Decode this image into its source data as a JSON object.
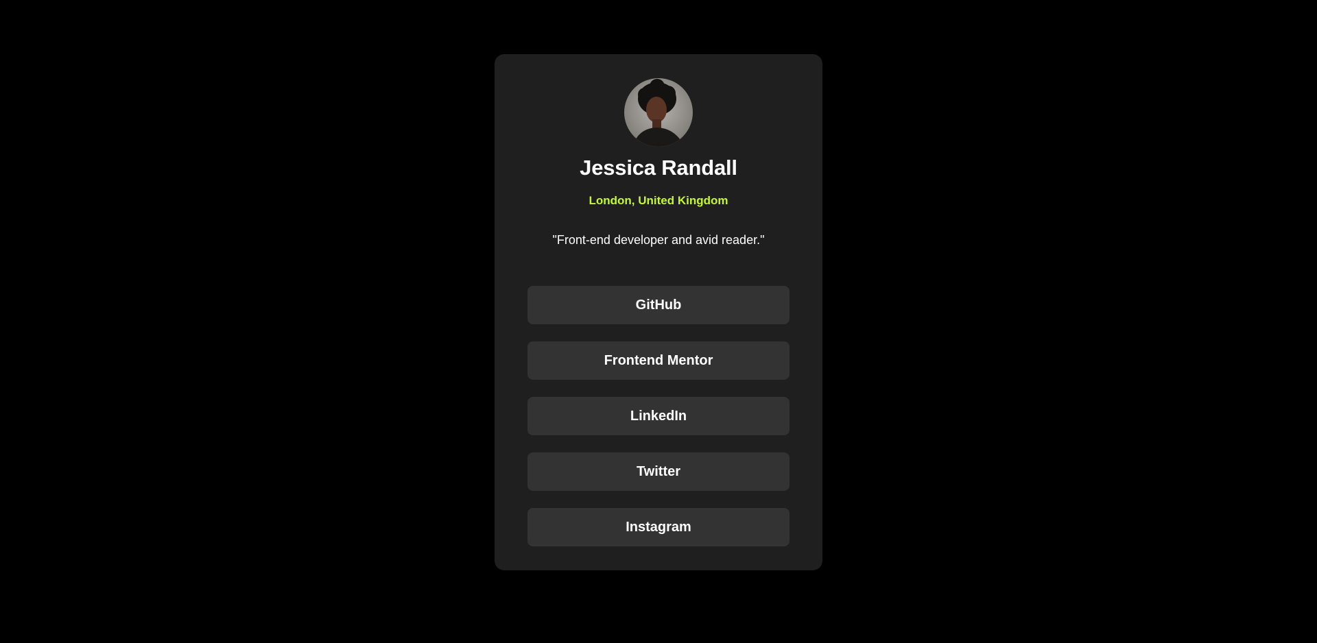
{
  "profile": {
    "name": "Jessica Randall",
    "location": "London, United Kingdom",
    "bio": "\"Front-end developer and avid reader.\""
  },
  "links": [
    {
      "label": "GitHub"
    },
    {
      "label": "Frontend Mentor"
    },
    {
      "label": "LinkedIn"
    },
    {
      "label": "Twitter"
    },
    {
      "label": "Instagram"
    }
  ],
  "colors": {
    "background": "#000000",
    "card": "#1f1f1f",
    "button": "#333333",
    "accent": "#c4f82a",
    "text": "#ffffff"
  }
}
